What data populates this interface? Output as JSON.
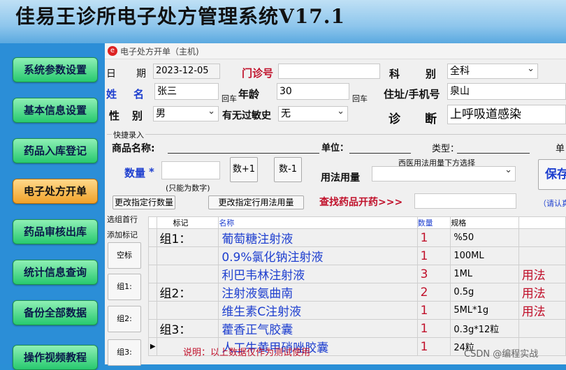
{
  "app": {
    "title": "佳易王诊所电子处方管理系统V17.1"
  },
  "sidebar": {
    "items": [
      {
        "label": "系统参数设置"
      },
      {
        "label": "基本信息设置"
      },
      {
        "label": "药品入库登记"
      },
      {
        "label": "电子处方开单",
        "active": true
      },
      {
        "label": "药品审核出库"
      },
      {
        "label": "统计信息查询"
      },
      {
        "label": "备份全部数据"
      },
      {
        "label": "操作视频教程"
      }
    ]
  },
  "window": {
    "title": "电子处方开单（主机)"
  },
  "form": {
    "date_label_1": "日",
    "date_label_2": "期",
    "date_value": "2023-12-05",
    "clinic_no_label": "门诊号",
    "clinic_no_value": "",
    "dept_label_1": "科",
    "dept_label_2": "别",
    "dept_value": "全科",
    "name_label_1": "姓",
    "name_label_2": "名",
    "name_value": "张三",
    "enter1": "回车",
    "age_label": "年龄",
    "age_value": "30",
    "enter2": "回车",
    "address_label": "住址/手机号",
    "address_value": "泉山",
    "gender_label_1": "性",
    "gender_label_2": "别",
    "gender_value": "男",
    "allergy_label": "有无过敏史",
    "allergy_value": "无",
    "diag_label_1": "诊",
    "diag_label_2": "断",
    "diag_value": "上呼吸道感染"
  },
  "quick": {
    "title": "快捷录入",
    "product_label": "商品名称:",
    "unit_label": "单位：",
    "type_label": "类型：",
    "unit2_label": "单",
    "qty_label": "数量",
    "qty_star": "*",
    "qty_note": "(只能为数字)",
    "plus_button": "数+1",
    "minus_button": "数-1",
    "usage_hint": "西医用法用量下方选择",
    "usage_label": "用法用量",
    "save_button": "保存",
    "change_qty_button": "更改指定行数量",
    "change_usage_button": "更改指定行用法用量",
    "search_label": "查找药品开药>>>",
    "search_hint": "（请认真"
  },
  "side_controls": {
    "select_first": "选组首行",
    "add_mark": "添加标记",
    "buttons": [
      "空标",
      "组1:",
      "组2:",
      "组3:"
    ]
  },
  "table": {
    "headers": [
      "标记",
      "名称",
      "数量",
      "规格"
    ],
    "rows": [
      {
        "mark": "组1：",
        "name": "葡萄糖注射液",
        "qty": "1",
        "spec": "%50",
        "usage": ""
      },
      {
        "mark": "",
        "name": "0.9%氯化钠注射液",
        "qty": "1",
        "spec": "100ML",
        "usage": ""
      },
      {
        "mark": "",
        "name": "利巴韦林注射液",
        "qty": "3",
        "spec": "1ML",
        "usage": "用法"
      },
      {
        "mark": "组2：",
        "name": "注射液氨曲南",
        "qty": "2",
        "spec": "0.5g",
        "usage": "用法"
      },
      {
        "mark": "",
        "name": "维生素C注射液",
        "qty": "1",
        "spec": "5ML*1g",
        "usage": "用法"
      },
      {
        "mark": "组3：",
        "name": "藿香正气胶囊",
        "qty": "1",
        "spec": "0.3g*12粒",
        "usage": ""
      },
      {
        "mark": "",
        "name": "人工牛黄甲硝唑胶囊",
        "qty": "1",
        "spec": "24粒",
        "usage": "",
        "current": true
      }
    ]
  },
  "footer": {
    "note": "说明：以上数据仅作为测试使用",
    "watermark": "CSDN @编程实战"
  }
}
